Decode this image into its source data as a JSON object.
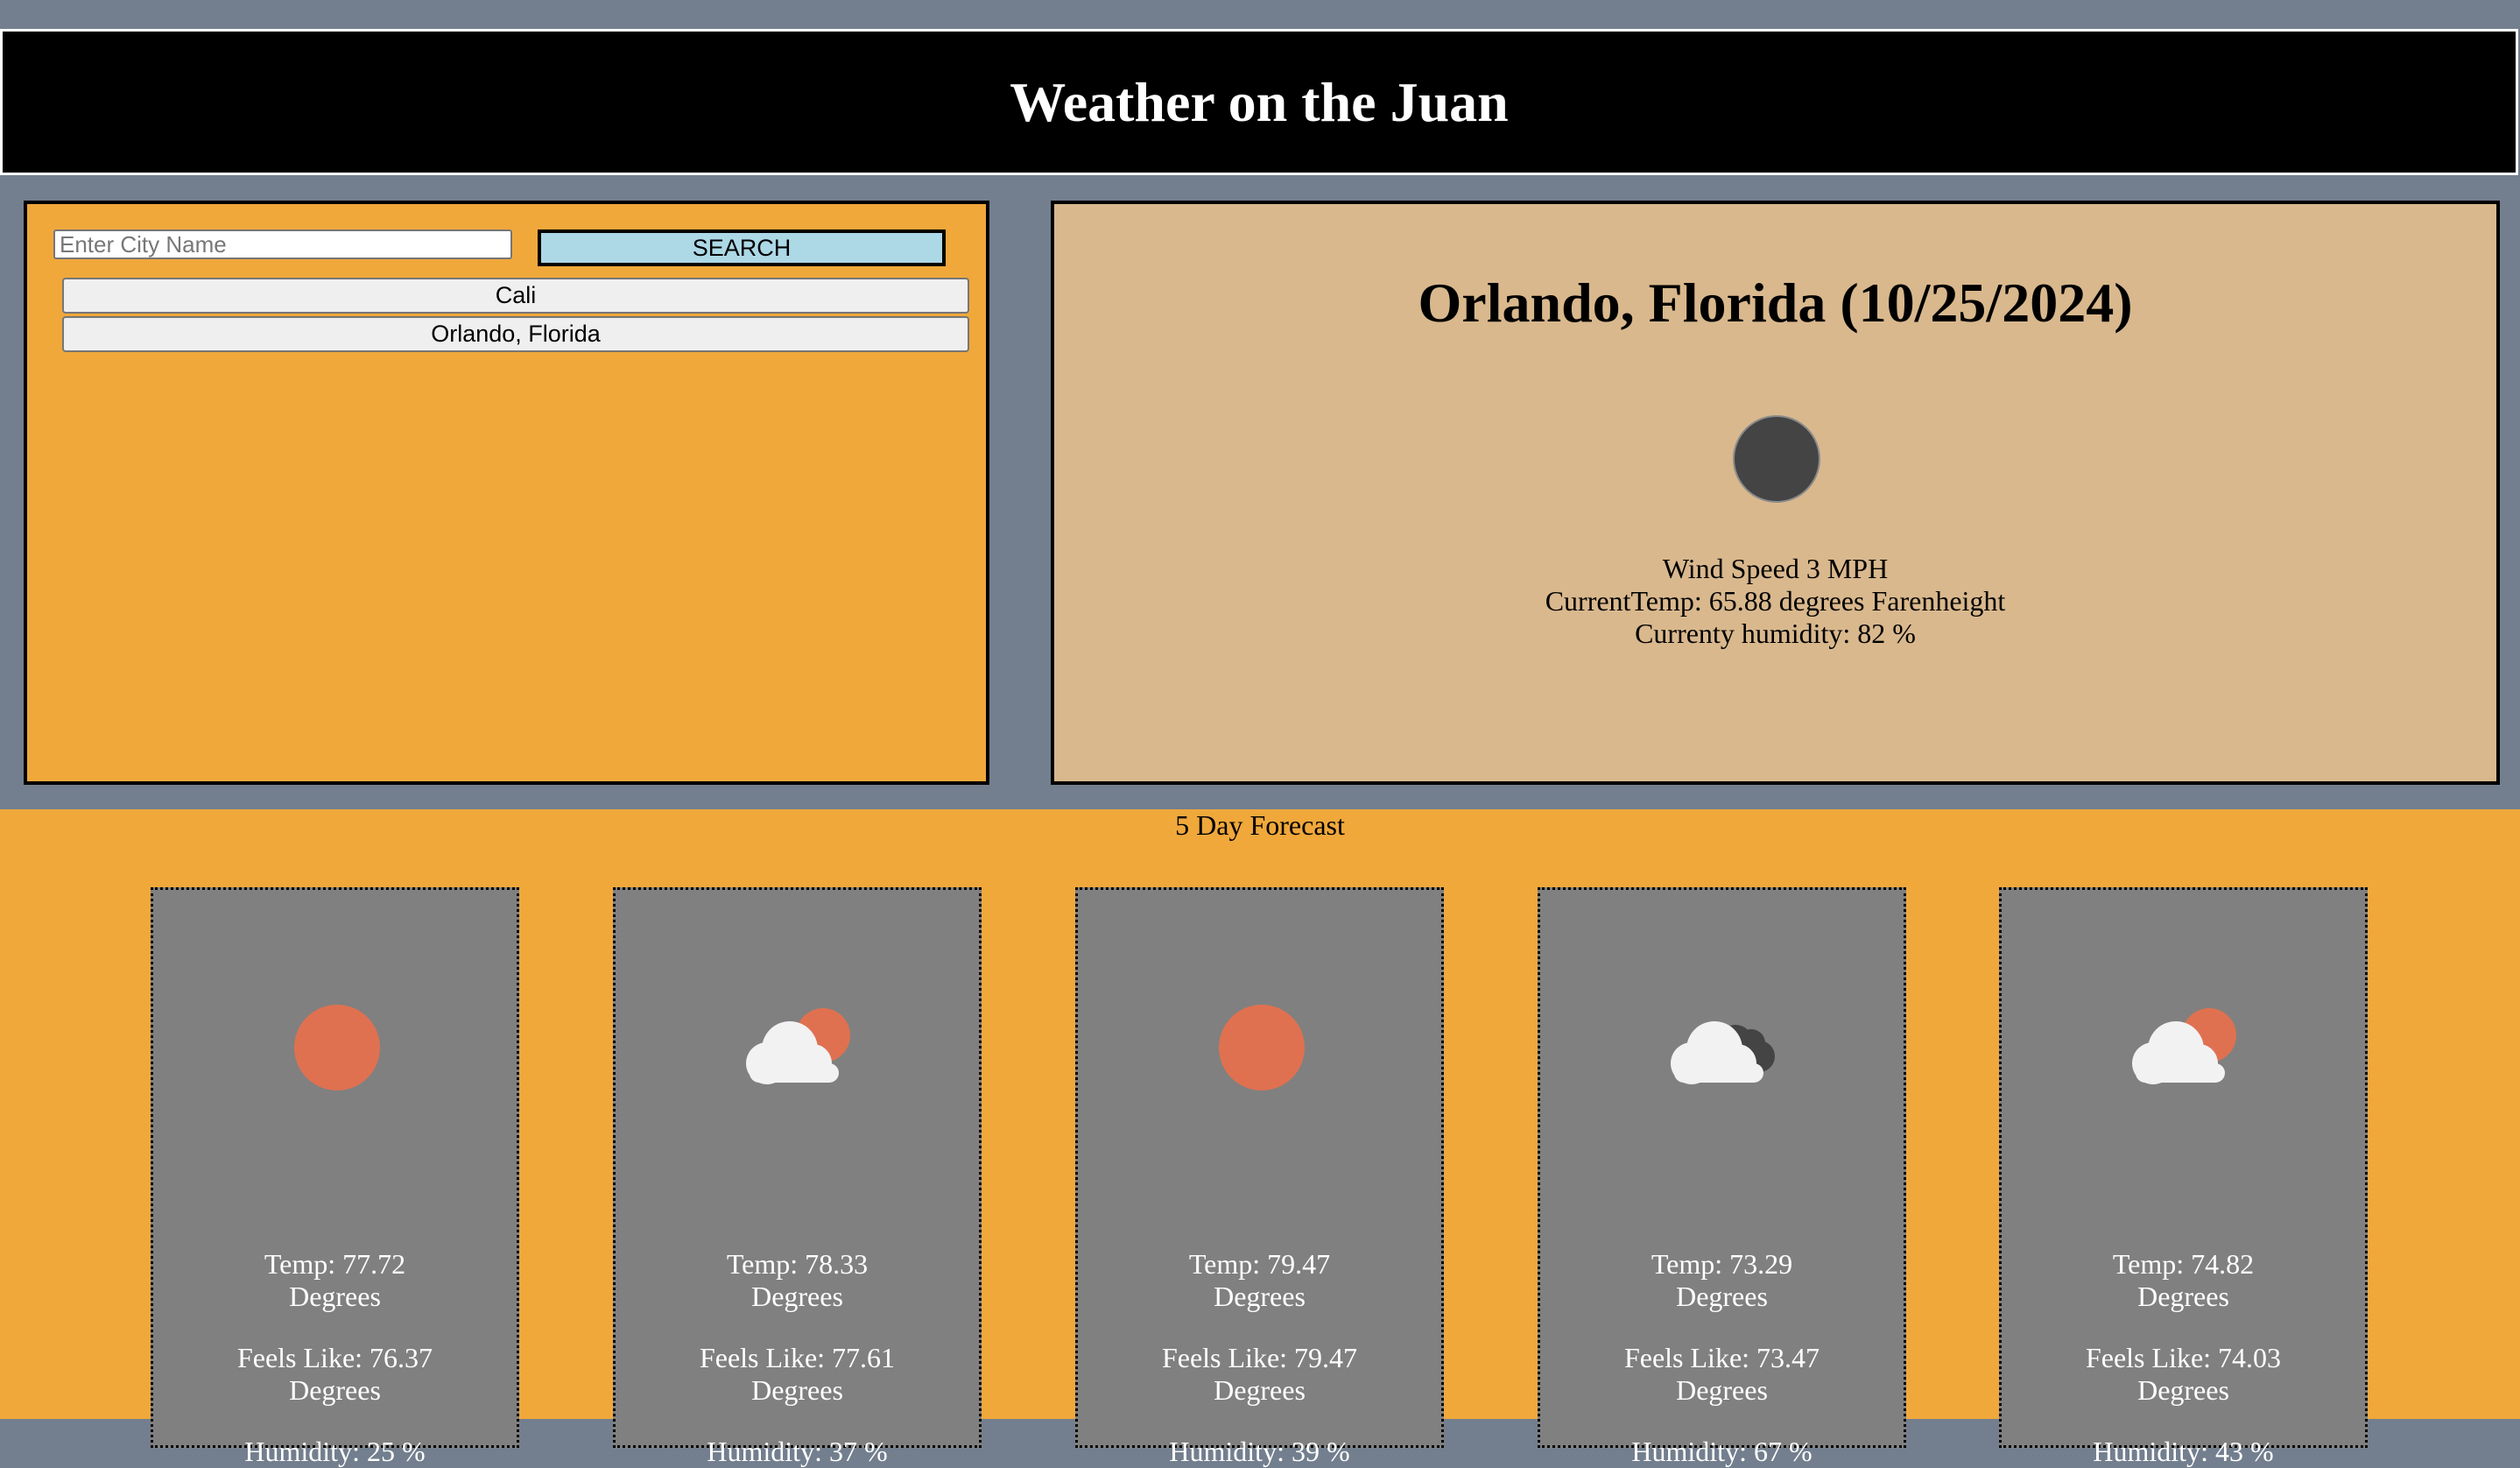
{
  "header": {
    "title": "Weather on the Juan"
  },
  "search": {
    "placeholder": "Enter City Name",
    "value": "",
    "button_label": "SEARCH"
  },
  "history": [
    "Cali",
    "Orlando, Florida"
  ],
  "current": {
    "title": "Orlando, Florida (10/25/2024)",
    "icon": "dark-moon-icon",
    "wind": "Wind Speed 3 MPH",
    "temp": "CurrentTemp: 65.88 degrees Farenheight",
    "humidity": "Currenty humidity: 82 %"
  },
  "forecast": {
    "heading": "5 Day Forecast",
    "days": [
      {
        "icon": "sun-icon",
        "temp": "Temp: 77.72",
        "temp_unit": "Degrees",
        "feels": "Feels Like: 76.37",
        "feels_unit": "Degrees",
        "humidity": "Humidity: 25 %"
      },
      {
        "icon": "partly-cloudy-icon",
        "temp": "Temp: 78.33",
        "temp_unit": "Degrees",
        "feels": "Feels Like: 77.61",
        "feels_unit": "Degrees",
        "humidity": "Humidity: 37 %"
      },
      {
        "icon": "sun-icon",
        "temp": "Temp: 79.47",
        "temp_unit": "Degrees",
        "feels": "Feels Like: 79.47",
        "feels_unit": "Degrees",
        "humidity": "Humidity: 39 %"
      },
      {
        "icon": "cloudy-icon",
        "temp": "Temp: 73.29",
        "temp_unit": "Degrees",
        "feels": "Feels Like: 73.47",
        "feels_unit": "Degrees",
        "humidity": "Humidity: 67 %"
      },
      {
        "icon": "partly-cloudy-icon",
        "temp": "Temp: 74.82",
        "temp_unit": "Degrees",
        "feels": "Feels Like: 74.03",
        "feels_unit": "Degrees",
        "humidity": "Humidity: 43 %"
      }
    ]
  },
  "colors": {
    "background": "#737f8e",
    "header_background": "#000000",
    "panel_orange": "#f0a83b",
    "current_panel": "#d9b88d",
    "search_button": "#add8e6",
    "forecast_card": "#808080",
    "sun": "#df7150",
    "cloud": "#f2f2f2",
    "dark_cloud": "#444444"
  }
}
